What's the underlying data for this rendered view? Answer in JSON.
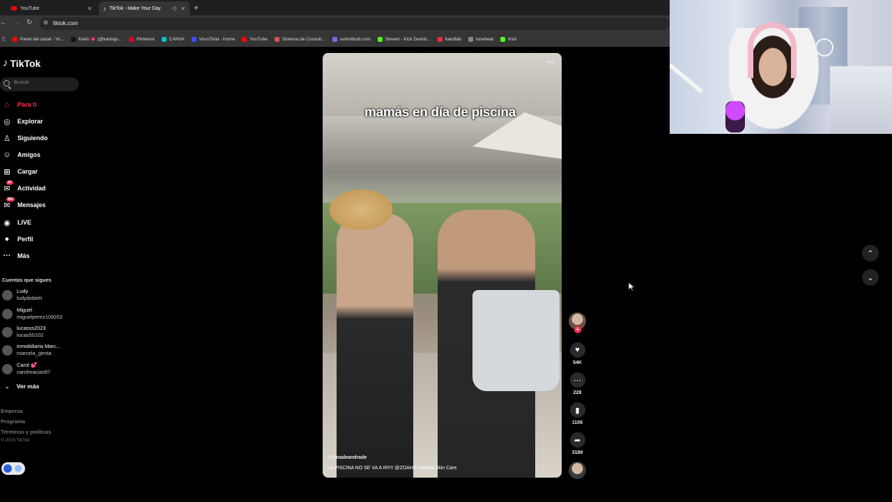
{
  "browser": {
    "tabs": [
      {
        "label": "YouTube",
        "active": false
      },
      {
        "label": "TikTok - Make Your Day",
        "active": true
      }
    ],
    "new_tab": "+",
    "url": "tiktok.com",
    "bookmarks": [
      {
        "label": "Panel del canal - Yo...",
        "color": "#ff0000"
      },
      {
        "label": "Karin 💗 (@karingu...",
        "color": "#111111"
      },
      {
        "label": "Pinterest",
        "color": "#e60023"
      },
      {
        "label": "CANVA",
        "color": "#00c4cc"
      },
      {
        "label": "VirusTotal - Home",
        "color": "#394eff"
      },
      {
        "label": "YouTube",
        "color": "#ff0000"
      },
      {
        "label": "Sistema de Consult...",
        "color": "#d9534f"
      },
      {
        "label": "submithub.com",
        "color": "#7b68ee"
      },
      {
        "label": "Stream - Kick Dashb...",
        "color": "#53fc18"
      },
      {
        "label": "bandlab",
        "color": "#f12c3a"
      },
      {
        "label": "tunebeat",
        "color": "#888888"
      },
      {
        "label": "Kick",
        "color": "#53fc18"
      }
    ]
  },
  "tiktok": {
    "logo": "TikTok",
    "search_placeholder": "Buscar",
    "nav": [
      {
        "label": "Para ti",
        "icon": "home-icon",
        "active": true
      },
      {
        "label": "Explorar",
        "icon": "compass-icon"
      },
      {
        "label": "Siguiendo",
        "icon": "following-icon"
      },
      {
        "label": "Amigos",
        "icon": "friends-icon"
      },
      {
        "label": "Cargar",
        "icon": "upload-icon"
      },
      {
        "label": "Actividad",
        "icon": "activity-icon",
        "badge": "47"
      },
      {
        "label": "Mensajes",
        "icon": "messages-icon",
        "badge": "99+"
      },
      {
        "label": "LIVE",
        "icon": "live-icon"
      },
      {
        "label": "Perfil",
        "icon": "profile-icon"
      },
      {
        "label": "Más",
        "icon": "more-icon"
      }
    ],
    "following_title": "Cuentas que sigues",
    "accounts": [
      {
        "name": "Ludy",
        "user": "ludydobleh"
      },
      {
        "name": "Miguel",
        "user": "miguelperez109202"
      },
      {
        "name": "lucasss2023",
        "user": "lucas50102"
      },
      {
        "name": "inmobiliaria Marc...",
        "user": "marcela_genta"
      },
      {
        "name": "Carol 💕",
        "user": "carolmacias97"
      }
    ],
    "see_more": "Ver más",
    "footer": [
      "Empresa",
      "Programa",
      "Términos y políticas"
    ],
    "copyright": "© 2025 TikTok",
    "video": {
      "caption": "mamás en día de piscina",
      "author": "@lanadeandrade",
      "description": "LA PISCINA NO SE VA A IR!!!! @ZOAH® Natural Skin Care",
      "more": "···"
    },
    "actions": {
      "likes": "54K",
      "comments": "228",
      "saves": "1106",
      "shares": "3189"
    }
  }
}
